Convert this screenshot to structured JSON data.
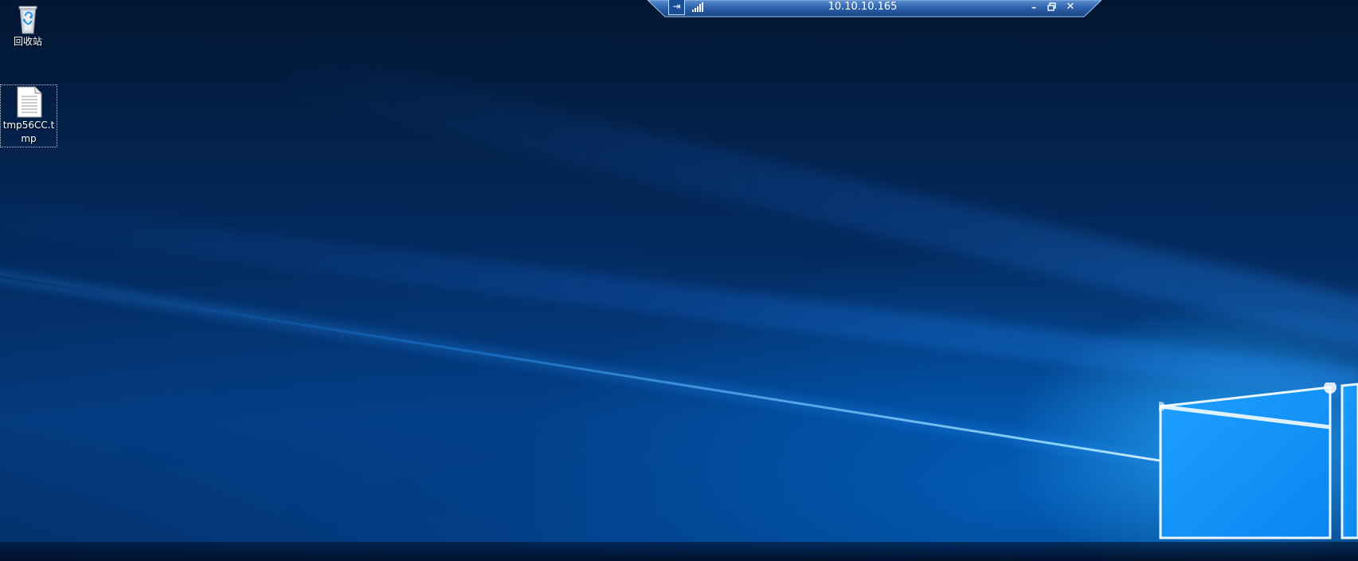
{
  "rdp_bar": {
    "title": "10.10.10.165",
    "pin_icon": "pin-icon",
    "signal_icon": "connection-quality-icon",
    "minimize_icon": "minimize-icon",
    "restore_icon": "restore-icon",
    "close_icon": "close-icon",
    "minimize_glyph": "–",
    "close_glyph": "✕",
    "pin_glyph": "⇥"
  },
  "desktop": {
    "icons": [
      {
        "label": "回收站",
        "icon": "recycle-bin-icon"
      },
      {
        "label": "tmp56CC.tmp",
        "icon": "file-icon"
      }
    ],
    "colors": {
      "background_dark": "#021632",
      "background_mid": "#04387a",
      "light_accent": "#1fa0ff"
    }
  }
}
